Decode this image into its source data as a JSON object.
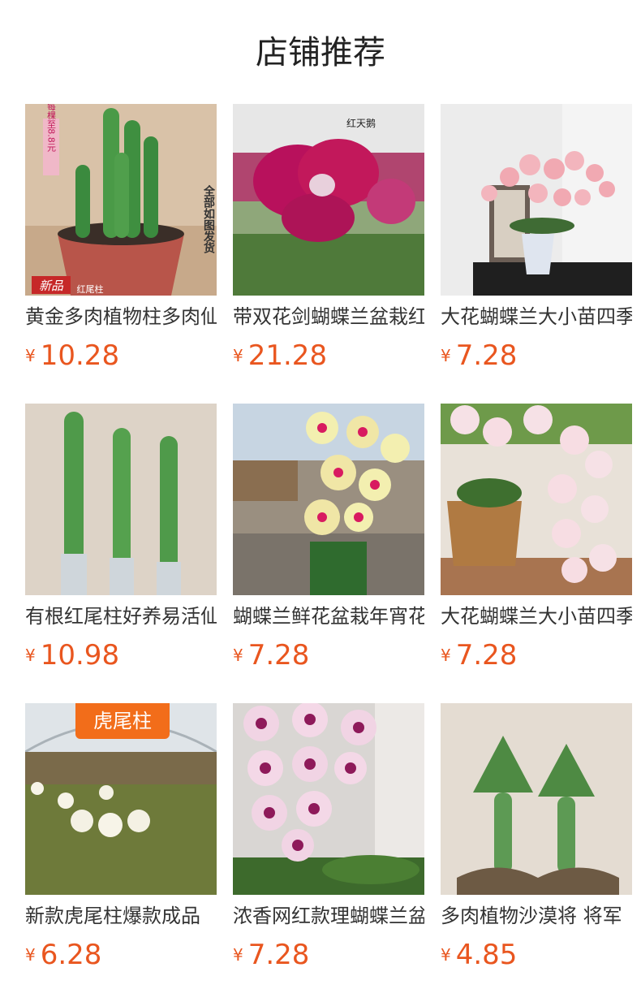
{
  "header": {
    "title": "店铺推荐"
  },
  "products": [
    {
      "name": "黄金多肉植物柱多肉仙人柱",
      "currency": "¥",
      "price": "10.28",
      "image_texts": [
        "每棵至8.8元",
        "全部如图发货",
        "新品",
        "红尾柱"
      ]
    },
    {
      "name": "带双花剑蝴蝶兰盆栽红天鹅",
      "currency": "¥",
      "price": "21.28",
      "image_texts": [
        "红天鹅"
      ]
    },
    {
      "name": "大花蝴蝶兰大小苗四季开花",
      "currency": "¥",
      "price": "7.28",
      "image_texts": []
    },
    {
      "name": "有根红尾柱好养易活仙人柱",
      "currency": "¥",
      "price": "10.98",
      "image_texts": []
    },
    {
      "name": "蝴蝶兰鲜花盆栽年宵花卉",
      "currency": "¥",
      "price": "7.28",
      "image_texts": []
    },
    {
      "name": "大花蝴蝶兰大小苗四季开花",
      "currency": "¥",
      "price": "7.28",
      "image_texts": []
    },
    {
      "name": "新款虎尾柱爆款成品",
      "currency": "¥",
      "price": "6.28",
      "image_texts": [
        "虎尾柱"
      ]
    },
    {
      "name": "浓香网红款理蝴蝶兰盆栽",
      "currency": "¥",
      "price": "7.28",
      "image_texts": []
    },
    {
      "name": "多肉植物沙漠将 将军",
      "currency": "¥",
      "price": "4.85",
      "image_texts": []
    }
  ],
  "colors": {
    "price": "#e9561f",
    "badge": "#f26d1a"
  }
}
